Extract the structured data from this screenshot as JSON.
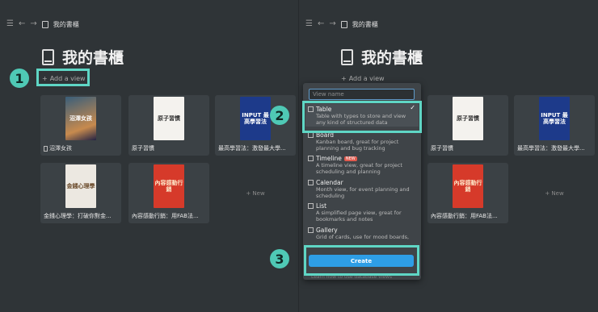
{
  "breadcrumb": {
    "title": "我的書櫃"
  },
  "page": {
    "title": "我的書櫃",
    "add_view": "Add a view"
  },
  "cards_left": [
    {
      "label": "沼澤女孩",
      "cover_text": "沼澤女孩"
    },
    {
      "label": "原子習慣",
      "cover_text": "原子習慣"
    },
    {
      "label": "最高學習法：激發最大學...",
      "cover_text": "INPUT 最高學習法"
    },
    {
      "label": "金錢心理學：打破你對金...",
      "cover_text": "金錢心理學"
    },
    {
      "label": "內容感動行銷：用FAB法...",
      "cover_text": "內容感動行銷"
    }
  ],
  "cards_right": [
    {
      "label": "原子習慣",
      "cover_text": "原子習慣"
    },
    {
      "label": "最高學習法：激發最大學...",
      "cover_text": "INPUT 最高學習法"
    },
    {
      "label": "內容感動行銷：用FAB法...",
      "cover_text": "內容感動行銷"
    }
  ],
  "new_label": "+ New",
  "steps": [
    "1",
    "2",
    "3"
  ],
  "menu": {
    "placeholder": "View name",
    "items": [
      {
        "title": "Table",
        "desc": "Table with types to store and view any kind of structured data"
      },
      {
        "title": "Board",
        "desc": "Kanban board, great for project planning and bug tracking"
      },
      {
        "title": "Timeline",
        "desc": "A timeline view, great for project scheduling and planning",
        "tag": "NEW"
      },
      {
        "title": "Calendar",
        "desc": "Month view, for event planning and scheduling"
      },
      {
        "title": "List",
        "desc": "A simplified page view, great for bookmarks and notes"
      },
      {
        "title": "Gallery",
        "desc": "Grid of cards, use for mood boards,"
      }
    ],
    "create": "Create",
    "learn": "Learn how to use database views"
  },
  "colors": {
    "accent": "#5fd6c5",
    "create": "#2e9ee6",
    "bg": "#2f3437"
  }
}
